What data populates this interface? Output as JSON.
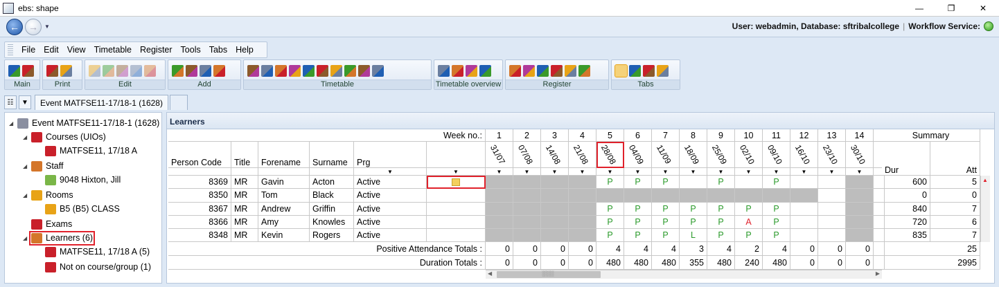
{
  "window": {
    "title": "ebs: shape"
  },
  "status": {
    "user_info": "User: webadmin, Database: sftribalcollege",
    "workflow": "Workflow Service:"
  },
  "menu": [
    "File",
    "Edit",
    "View",
    "Timetable",
    "Register",
    "Tools",
    "Tabs",
    "Help"
  ],
  "ribbon_groups": [
    {
      "label": "Main",
      "icons": [
        "save-icon",
        "refresh-icon"
      ]
    },
    {
      "label": "Print",
      "icons": [
        "print-icon",
        "print-preview-icon"
      ]
    },
    {
      "label": "Edit",
      "icons": [
        "copy-icon",
        "paste-icon",
        "undo-icon",
        "delete-icon",
        "properties-icon"
      ]
    },
    {
      "label": "Add",
      "icons": [
        "add-course-icon",
        "add-staff-icon",
        "add-room-icon",
        "add-learner-icon"
      ]
    },
    {
      "label": "Timetable",
      "icons": [
        "staff-timetable-icon",
        "event-timetable-icon",
        "course-timetable-icon",
        "room-timetable-icon",
        "resource-timetable-icon",
        "learner-timetable-icon",
        "group-timetable-icon",
        "grid-timetable-icon",
        "week-grid-icon",
        "split-icon"
      ]
    },
    {
      "label": "Timetable overview",
      "icons": [
        "overview-course-icon",
        "overview-staff-icon",
        "overview-room-icon",
        "overview-split-icon"
      ]
    },
    {
      "label": "Register",
      "icons": [
        "register-grid-icon",
        "register-event-icon",
        "register-course-icon",
        "register-room-icon",
        "register-learner-icon",
        "register-marks-icon"
      ]
    },
    {
      "label": "Tabs",
      "icons": [
        "tab-single-icon",
        "tab-horizontal-icon",
        "tab-vertical-icon",
        "tab-grid-icon"
      ]
    }
  ],
  "tabs": {
    "active": "Event MATFSE11-17/18-1 (1628)"
  },
  "tree": [
    {
      "label": "Event MATFSE11-17/18-1 (1628)",
      "icon": "event-grid-icon",
      "level": 0,
      "expanded": true
    },
    {
      "label": "Courses (UIOs)",
      "icon": "courses-icon",
      "level": 1,
      "expanded": true
    },
    {
      "label": "MATFSE11, 17/18 A",
      "icon": "book-icon",
      "level": 2
    },
    {
      "label": "Staff",
      "icon": "staff-icon",
      "level": 1,
      "expanded": true
    },
    {
      "label": "9048 Hixton, Jill",
      "icon": "person-icon",
      "level": 2
    },
    {
      "label": "Rooms",
      "icon": "rooms-icon",
      "level": 1,
      "expanded": true
    },
    {
      "label": "B5 (B5) CLASS",
      "icon": "room-icon",
      "level": 2
    },
    {
      "label": "Exams",
      "icon": "exams-icon",
      "level": 1
    },
    {
      "label": "Learners (6)",
      "icon": "learners-icon",
      "level": 1,
      "expanded": true,
      "highlighted": true
    },
    {
      "label": "MATFSE11, 17/18 A  (5)",
      "icon": "learner-group-icon",
      "level": 2
    },
    {
      "label": "Not on course/group (1)",
      "icon": "learner-group-icon",
      "level": 2
    }
  ],
  "register": {
    "panel_title": "Learners",
    "week_label": "Week no.:",
    "summary_label": "Summary",
    "columns": [
      "Person Code",
      "Title",
      "Forename",
      "Surname",
      "Prg"
    ],
    "summary_columns": [
      "Dur",
      "Att"
    ],
    "weeks": [
      {
        "no": "1",
        "date": "31/07"
      },
      {
        "no": "2",
        "date": "07/08"
      },
      {
        "no": "3",
        "date": "14/08"
      },
      {
        "no": "4",
        "date": "21/08"
      },
      {
        "no": "5",
        "date": "28/08"
      },
      {
        "no": "6",
        "date": "04/09"
      },
      {
        "no": "7",
        "date": "11/09"
      },
      {
        "no": "8",
        "date": "18/09"
      },
      {
        "no": "9",
        "date": "25/09"
      },
      {
        "no": "10",
        "date": "02/10"
      },
      {
        "no": "11",
        "date": "09/10"
      },
      {
        "no": "12",
        "date": "16/10"
      },
      {
        "no": "13",
        "date": "23/10"
      },
      {
        "no": "14",
        "date": "30/10"
      }
    ],
    "rows": [
      {
        "code": "8369",
        "title": "MR",
        "forename": "Gavin",
        "surname": "Acton",
        "prg": "Active",
        "marks": [
          "#",
          "#",
          "#",
          "#",
          "P",
          "P",
          "P",
          "",
          "P",
          "",
          "P",
          "",
          "",
          "#"
        ],
        "dur": "600",
        "att": "5"
      },
      {
        "code": "8350",
        "title": "MR",
        "forename": "Tom",
        "surname": "Black",
        "prg": "Active",
        "marks": [
          "#",
          "#",
          "#",
          "#",
          "#",
          "#",
          "#",
          "#",
          "#",
          "#",
          "#",
          "#",
          "",
          "#"
        ],
        "dur": "0",
        "att": "0"
      },
      {
        "code": "8367",
        "title": "MR",
        "forename": "Andrew",
        "surname": "Griffin",
        "prg": "Active",
        "marks": [
          "#",
          "#",
          "#",
          "#",
          "P",
          "P",
          "P",
          "P",
          "P",
          "P",
          "P",
          "",
          "",
          "#"
        ],
        "dur": "840",
        "att": "7"
      },
      {
        "code": "8366",
        "title": "MR",
        "forename": "Amy",
        "surname": "Knowles",
        "prg": "Active",
        "marks": [
          "#",
          "#",
          "#",
          "#",
          "P",
          "P",
          "P",
          "P",
          "P",
          "A",
          "P",
          "",
          "",
          "#"
        ],
        "dur": "720",
        "att": "6"
      },
      {
        "code": "8348",
        "title": "MR",
        "forename": "Kevin",
        "surname": "Rogers",
        "prg": "Active",
        "marks": [
          "#",
          "#",
          "#",
          "#",
          "P",
          "P",
          "P",
          "L",
          "P",
          "P",
          "P",
          "",
          "",
          "#"
        ],
        "dur": "835",
        "att": "7"
      }
    ],
    "positive_label": "Positive Attendance Totals :",
    "positive_totals": [
      "0",
      "0",
      "0",
      "0",
      "4",
      "4",
      "4",
      "3",
      "4",
      "2",
      "4",
      "0",
      "0",
      "0"
    ],
    "positive_summary": "25",
    "duration_label": "Duration Totals :",
    "duration_totals": [
      "0",
      "0",
      "0",
      "0",
      "480",
      "480",
      "480",
      "355",
      "480",
      "240",
      "480",
      "0",
      "0",
      "0"
    ],
    "duration_summary": "2995",
    "scroll_grip": "░░░"
  }
}
